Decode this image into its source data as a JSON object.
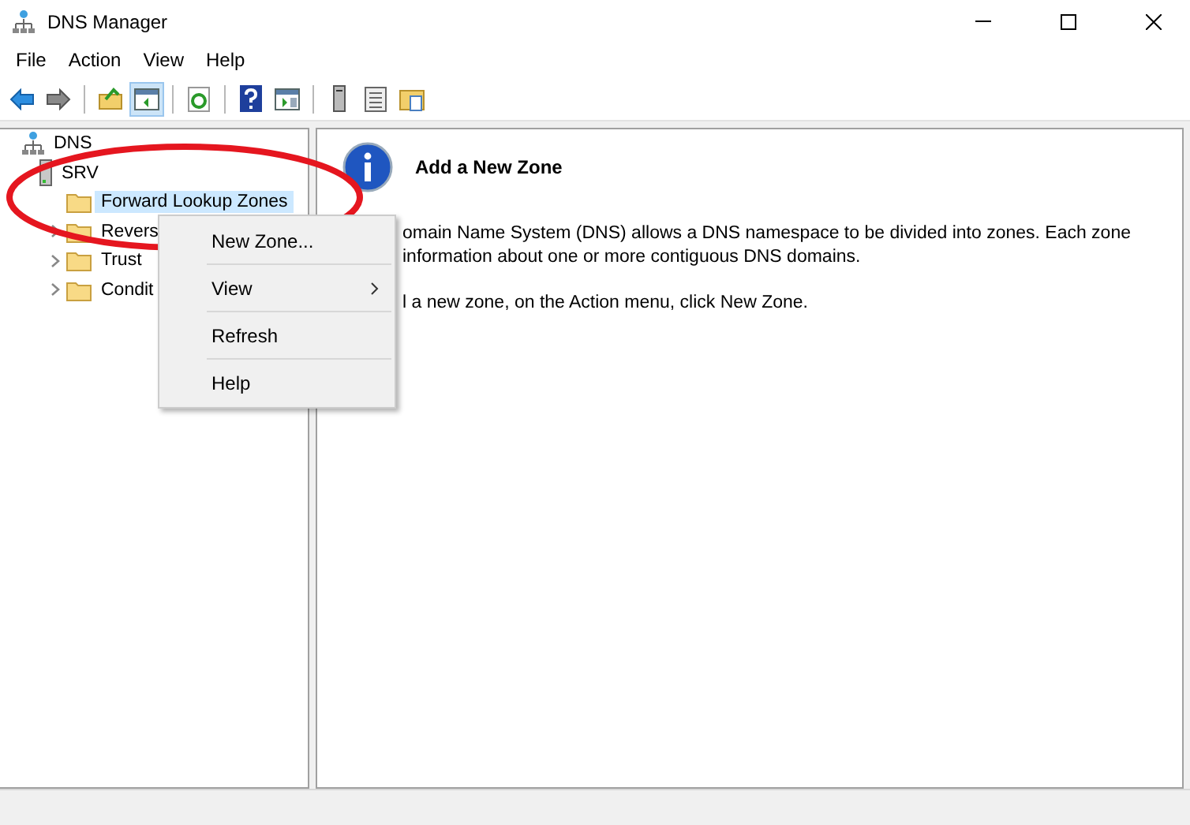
{
  "window": {
    "title": "DNS Manager"
  },
  "menu_bar": [
    {
      "label": "File"
    },
    {
      "label": "Action"
    },
    {
      "label": "View"
    },
    {
      "label": "Help"
    }
  ],
  "toolbar": [
    {
      "kind": "back",
      "selected": false
    },
    {
      "kind": "forward",
      "selected": false
    },
    {
      "kind": "sep"
    },
    {
      "kind": "up",
      "selected": false
    },
    {
      "kind": "pane",
      "selected": true
    },
    {
      "kind": "sep"
    },
    {
      "kind": "refresh",
      "selected": false
    },
    {
      "kind": "sep"
    },
    {
      "kind": "help",
      "selected": false
    },
    {
      "kind": "action-pane",
      "selected": false
    },
    {
      "kind": "sep"
    },
    {
      "kind": "server",
      "selected": false
    },
    {
      "kind": "list",
      "selected": false
    },
    {
      "kind": "folder",
      "selected": false
    }
  ],
  "tree": [
    {
      "label": "DNS",
      "kind": "root",
      "children": [
        {
          "label": "SRV",
          "kind": "server",
          "children": [
            {
              "label": "Forward Lookup Zones",
              "kind": "folder",
              "selected": true,
              "expandable": false
            },
            {
              "label": "Revers",
              "kind": "folder",
              "selected": false,
              "expandable": true
            },
            {
              "label": "Trust",
              "kind": "folder",
              "selected": false,
              "expandable": true
            },
            {
              "label": "Condit",
              "kind": "folder",
              "selected": false,
              "expandable": true
            }
          ]
        }
      ]
    }
  ],
  "context_menu": [
    {
      "label": "New Zone...",
      "kind": "item"
    },
    {
      "label": "View",
      "kind": "submenu"
    },
    {
      "label": "Refresh",
      "kind": "item"
    },
    {
      "label": "Help",
      "kind": "item"
    }
  ],
  "details": {
    "heading": "Add a New Zone",
    "paragraphs": [
      [
        "omain Name System (DNS) allows a DNS namespace to be divided into zones. Each zone",
        "information about one or more contiguous DNS domains."
      ],
      [
        "l a new zone, on the Action menu, click New Zone."
      ]
    ]
  }
}
